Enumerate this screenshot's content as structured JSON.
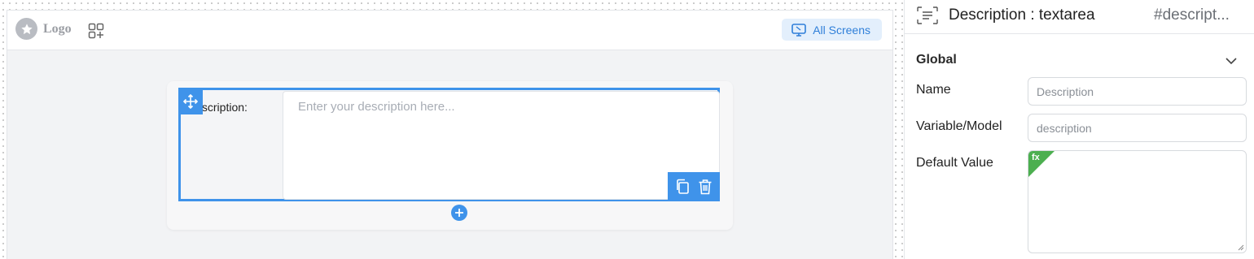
{
  "header": {
    "logo_text": "Logo",
    "all_screens_label": "All Screens"
  },
  "form": {
    "field_label": "Description:",
    "field_placeholder": "Enter your description here..."
  },
  "panel": {
    "title": "Description : textarea",
    "element_id": "#descript...",
    "section": "Global",
    "name_label": "Name",
    "name_value": "Description",
    "variable_label": "Variable/Model",
    "variable_value": "description",
    "default_label": "Default Value",
    "fx_badge": "fx"
  },
  "colors": {
    "accent": "#3f93ea",
    "accent_light": "#e3effc",
    "fx_green": "#4caf50"
  },
  "icons": [
    "logo-star-icon",
    "add-widget-icon",
    "screen-icon",
    "move-icon",
    "copy-icon",
    "delete-icon",
    "plus-icon",
    "textarea-type-icon",
    "chevron-down-icon"
  ]
}
